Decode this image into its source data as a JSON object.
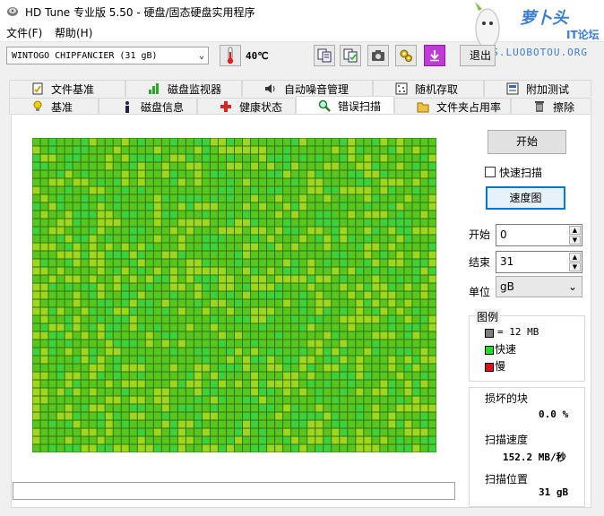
{
  "window": {
    "title": "HD Tune 专业版 5.50 - 硬盘/固态硬盘实用程序"
  },
  "menu": [
    {
      "label": "文件(F)"
    },
    {
      "label": "帮助(H)"
    }
  ],
  "watermark": {
    "brand": "萝卜头",
    "sub": "IT论坛",
    "url": "BBS.LUOBOTOU.ORG"
  },
  "toolbar": {
    "drive": "WINTOGO CHIPFANCIER (31 gB)",
    "temperature": "40℃",
    "exit_label": "退出"
  },
  "tabs_top": [
    {
      "label": "文件基准",
      "icon": "benchmark-file-icon"
    },
    {
      "label": "磁盘监视器",
      "icon": "disk-monitor-icon"
    },
    {
      "label": "自动噪音管理",
      "icon": "speaker-icon"
    },
    {
      "label": "随机存取",
      "icon": "random-access-icon"
    },
    {
      "label": "附加测试",
      "icon": "extra-tests-icon"
    }
  ],
  "tabs_bottom": [
    {
      "label": "基准",
      "icon": "bulb-icon"
    },
    {
      "label": "磁盘信息",
      "icon": "info-icon"
    },
    {
      "label": "健康状态",
      "icon": "health-cross-icon"
    },
    {
      "label": "错误扫描",
      "icon": "magnifier-icon",
      "active": true
    },
    {
      "label": "文件夹占用率",
      "icon": "folder-icon"
    },
    {
      "label": "擦除",
      "icon": "trash-icon"
    }
  ],
  "controls": {
    "start_label": "开始",
    "quick_scan_label": "快速扫描",
    "quick_scan_checked": false,
    "speed_map_label": "速度图",
    "start_field_label": "开始",
    "start_value": "0",
    "end_field_label": "结束",
    "end_value": "31",
    "unit_label": "单位",
    "unit_value": "gB"
  },
  "legend": {
    "title": "图例",
    "block_size": "= 12 MB",
    "fast_label": "快速",
    "slow_label": "慢",
    "colors": {
      "block": "#808080",
      "fast": "#22dd22",
      "slow": "#dd1111"
    }
  },
  "stats": {
    "damaged_label": "损坏的块",
    "damaged_value": "0.0 %",
    "speed_label": "扫描速度",
    "speed_value": "152.2 MB/秒",
    "position_label": "扫描位置",
    "position_value": "31 gB"
  },
  "scan_grid": {
    "cols": 50,
    "rows": 39,
    "status": "all blocks scanned, no damaged blocks"
  },
  "colors": {
    "grid_green": "#55c81e",
    "grid_yellowgreen": "#9ed81e",
    "grid_lime": "#3cd23c"
  }
}
